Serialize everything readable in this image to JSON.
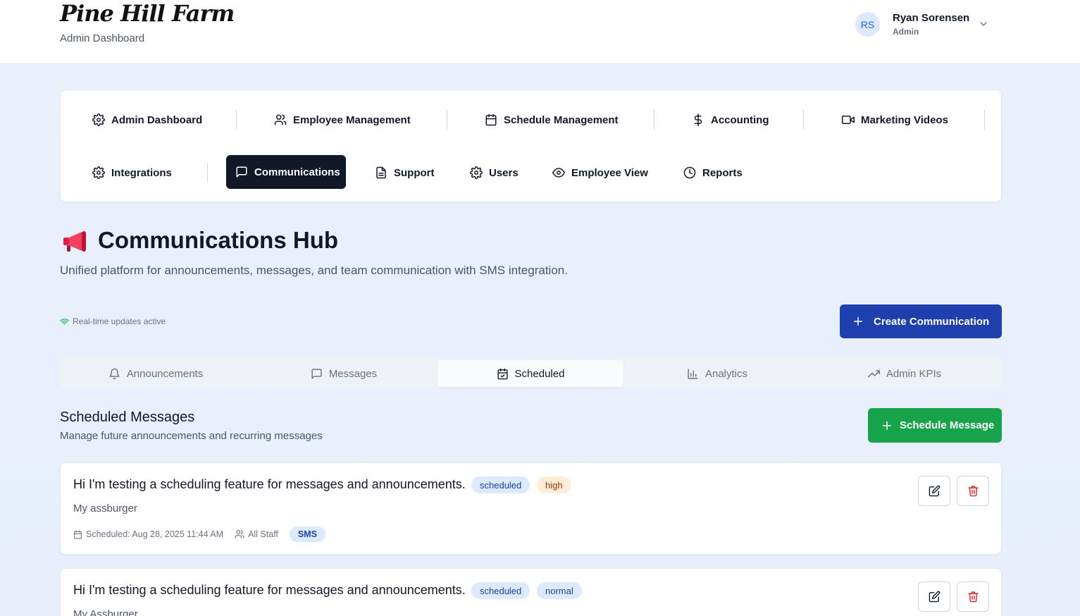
{
  "header": {
    "logo": "Pine Hill Farm",
    "subtitle": "Admin Dashboard",
    "user": {
      "initials": "RS",
      "name": "Ryan Sorensen",
      "role": "Admin"
    }
  },
  "nav": {
    "row1": [
      {
        "label": "Admin Dashboard",
        "icon": "gear-icon"
      },
      {
        "label": "Employee Management",
        "icon": "users-icon"
      },
      {
        "label": "Schedule Management",
        "icon": "calendar-icon"
      },
      {
        "label": "Accounting",
        "icon": "dollar-icon"
      },
      {
        "label": "Marketing Videos",
        "icon": "video-icon"
      }
    ],
    "row2": [
      {
        "label": "Integrations",
        "icon": "gear-icon"
      },
      {
        "label": "Communications",
        "icon": "message-icon",
        "active": true
      },
      {
        "label": "Support",
        "icon": "document-icon"
      },
      {
        "label": "Users",
        "icon": "gear-icon"
      },
      {
        "label": "Employee View",
        "icon": "eye-icon"
      },
      {
        "label": "Reports",
        "icon": "clock-icon"
      }
    ]
  },
  "page": {
    "title": "Communications Hub",
    "subtitle": "Unified platform for announcements, messages, and team communication with SMS integration.",
    "realtime": "Real-time updates active",
    "create_label": "Create Communication"
  },
  "tabs": [
    {
      "label": "Announcements",
      "icon": "bell-icon"
    },
    {
      "label": "Messages",
      "icon": "message-icon"
    },
    {
      "label": "Scheduled",
      "icon": "calendar-check-icon",
      "active": true
    },
    {
      "label": "Analytics",
      "icon": "bar-chart-icon"
    },
    {
      "label": "Admin KPIs",
      "icon": "trending-up-icon"
    }
  ],
  "scheduled": {
    "title": "Scheduled Messages",
    "subtitle": "Manage future announcements and recurring messages",
    "button_label": "Schedule Message",
    "items": [
      {
        "title": "Hi I'm testing a scheduling feature for messages and announcements.",
        "status": "scheduled",
        "priority": "high",
        "body": "My assburger",
        "scheduled": "Scheduled: Aug 28, 2025 11:44 AM",
        "audience": "All Staff",
        "channel": "SMS"
      },
      {
        "title": "Hi I'm testing a scheduling feature for messages and announcements.",
        "status": "scheduled",
        "priority": "normal",
        "body": "My Assburger"
      }
    ]
  },
  "colors": {
    "primary_blue": "#1e40af",
    "success_green": "#16a34a",
    "nav_active": "#111827",
    "delete_red": "#dc2626"
  }
}
